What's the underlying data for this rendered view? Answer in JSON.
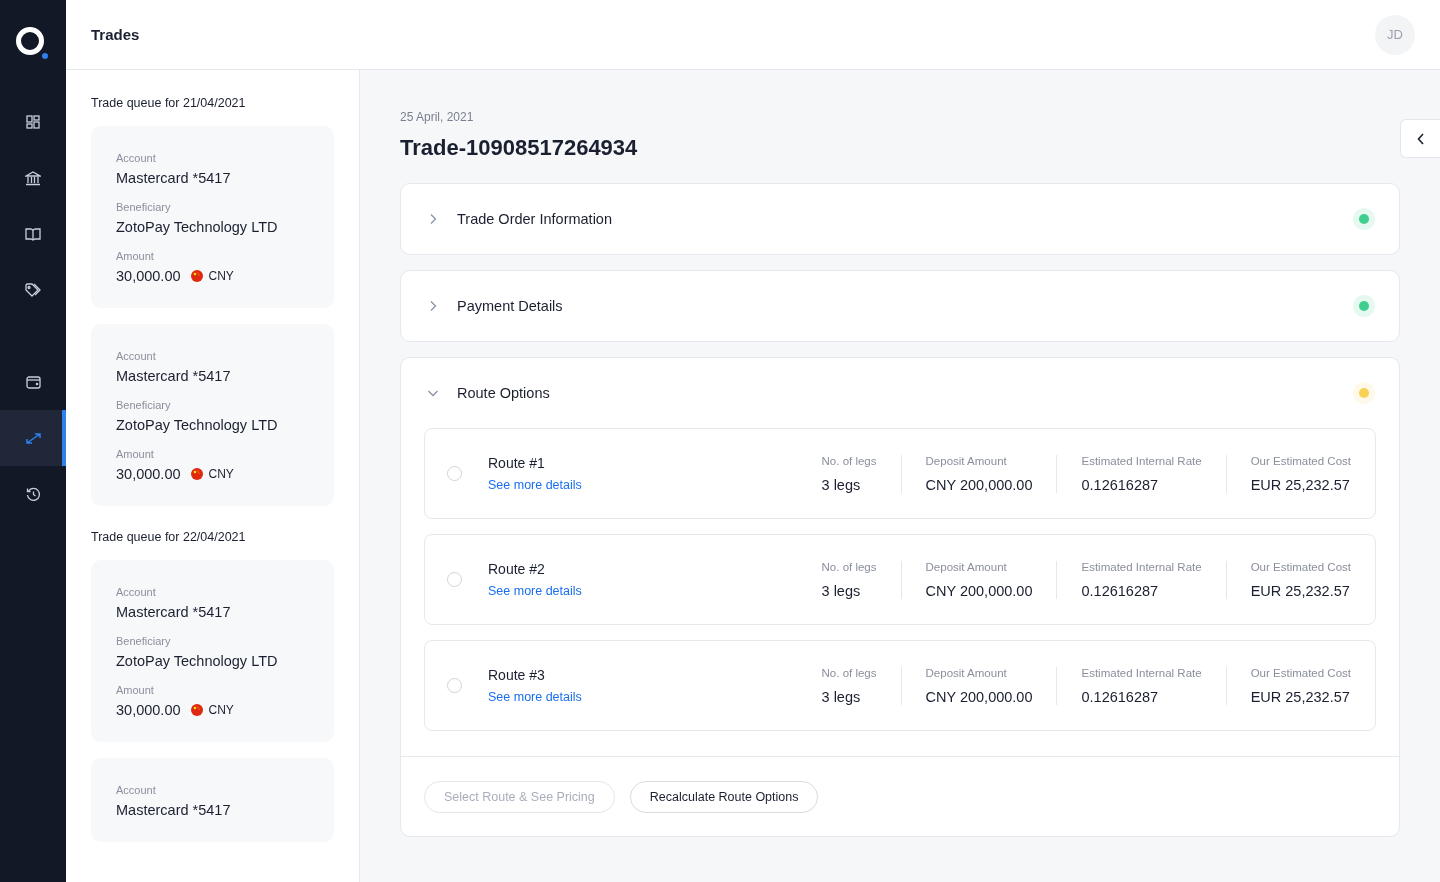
{
  "header": {
    "title": "Trades",
    "avatar": "JD"
  },
  "nav_groups": [
    [
      {
        "kind": "grid",
        "selected": false
      },
      {
        "kind": "bank",
        "selected": false
      },
      {
        "kind": "book",
        "selected": false
      },
      {
        "kind": "tag",
        "selected": false
      }
    ],
    [
      {
        "kind": "wallet",
        "selected": false
      },
      {
        "kind": "arrows",
        "selected": true
      },
      {
        "kind": "history",
        "selected": false
      }
    ]
  ],
  "queues": [
    {
      "heading": "Trade queue for 21/04/2021",
      "cards": [
        {
          "fields": [
            {
              "label": "Account",
              "value": "Mastercard *5417"
            },
            {
              "label": "Beneficiary",
              "value": "ZotoPay Technology LTD"
            },
            {
              "label": "Amount",
              "value": "30,000.00",
              "currency": "CNY"
            }
          ]
        },
        {
          "fields": [
            {
              "label": "Account",
              "value": "Mastercard *5417"
            },
            {
              "label": "Beneficiary",
              "value": "ZotoPay Technology LTD"
            },
            {
              "label": "Amount",
              "value": "30,000.00",
              "currency": "CNY"
            }
          ]
        }
      ]
    },
    {
      "heading": "Trade queue for 22/04/2021",
      "cards": [
        {
          "fields": [
            {
              "label": "Account",
              "value": "Mastercard *5417"
            },
            {
              "label": "Beneficiary",
              "value": "ZotoPay Technology LTD"
            },
            {
              "label": "Amount",
              "value": "30,000.00",
              "currency": "CNY"
            }
          ]
        },
        {
          "fields": [
            {
              "label": "Account",
              "value": "Mastercard *5417"
            }
          ]
        }
      ]
    }
  ],
  "trade": {
    "date": "25 April, 2021",
    "title": "Trade-10908517264934"
  },
  "sections": [
    {
      "title": "Trade Order Information",
      "expanded": false,
      "color": "#3ecf8e"
    },
    {
      "title": "Payment Details",
      "expanded": false,
      "color": "#3ecf8e"
    },
    {
      "title": "Route Options",
      "expanded": true,
      "color": "#f7d154",
      "routes": [
        {
          "name": "Route #1",
          "link": "See more details",
          "selected": false,
          "metrics": [
            {
              "label": "No. of legs",
              "value": "3 legs"
            },
            {
              "label": "Deposit Amount",
              "value": "CNY 200,000.00"
            },
            {
              "label": "Estimated Internal Rate",
              "value": "0.12616287"
            },
            {
              "label": "Our Estimated Cost",
              "value": "EUR 25,232.57"
            }
          ]
        },
        {
          "name": "Route #2",
          "link": "See more details",
          "selected": false,
          "metrics": [
            {
              "label": "No. of legs",
              "value": "3 legs"
            },
            {
              "label": "Deposit Amount",
              "value": "CNY 200,000.00"
            },
            {
              "label": "Estimated Internal Rate",
              "value": "0.12616287"
            },
            {
              "label": "Our Estimated Cost",
              "value": "EUR 25,232.57"
            }
          ]
        },
        {
          "name": "Route #3",
          "link": "See more details",
          "selected": false,
          "metrics": [
            {
              "label": "No. of legs",
              "value": "3 legs"
            },
            {
              "label": "Deposit Amount",
              "value": "CNY 200,000.00"
            },
            {
              "label": "Estimated Internal Rate",
              "value": "0.12616287"
            },
            {
              "label": "Our Estimated Cost",
              "value": "EUR 25,232.57"
            }
          ]
        }
      ],
      "buttons": [
        {
          "label": "Select Route & See Pricing",
          "disabled": true
        },
        {
          "label": "Recalculate Route Options",
          "disabled": false
        }
      ]
    }
  ]
}
